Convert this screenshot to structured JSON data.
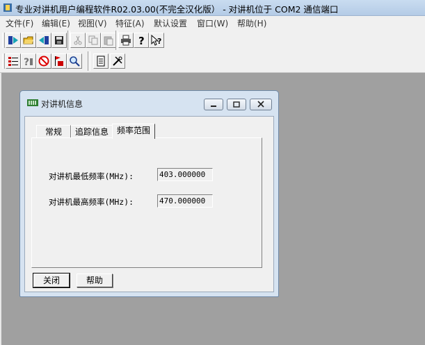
{
  "window_title": "专业对讲机用户编程软件R02.03.00(不完全汉化版） - 对讲机位于 COM2 通信端口",
  "menu": [
    "文件(F)",
    "编辑(E)",
    "视图(V)",
    "特征(A)",
    "默认设置",
    "窗口(W)",
    "帮助(H)"
  ],
  "toolbar_row1_icons": [
    "read-radio-icon",
    "open-file-icon",
    "write-radio-icon",
    "save-icon",
    "cut-icon",
    "copy-icon",
    "paste-icon",
    "print-icon",
    "help-icon",
    "context-help-icon"
  ],
  "toolbar_row2_icons": [
    "channel-list-icon",
    "question-config-icon",
    "no-entry-icon",
    "flag-radio-icon",
    "search-icon",
    "document-icon",
    "tools-icon"
  ],
  "dialog": {
    "title": "对讲机信息",
    "tabs": [
      "常规",
      "追踪信息",
      "频率范围"
    ],
    "active_tab": "频率范围",
    "fields": [
      {
        "label": "对讲机最低频率(MHz):",
        "value": "403.000000"
      },
      {
        "label": "对讲机最高频率(MHz):",
        "value": "470.000000"
      }
    ],
    "close_button": "关闭",
    "help_button": "帮助"
  },
  "colors": {
    "mdi_background": "#a0a0a0",
    "dialog_frame": "#d6e3f1",
    "face": "#f0f0f0"
  }
}
